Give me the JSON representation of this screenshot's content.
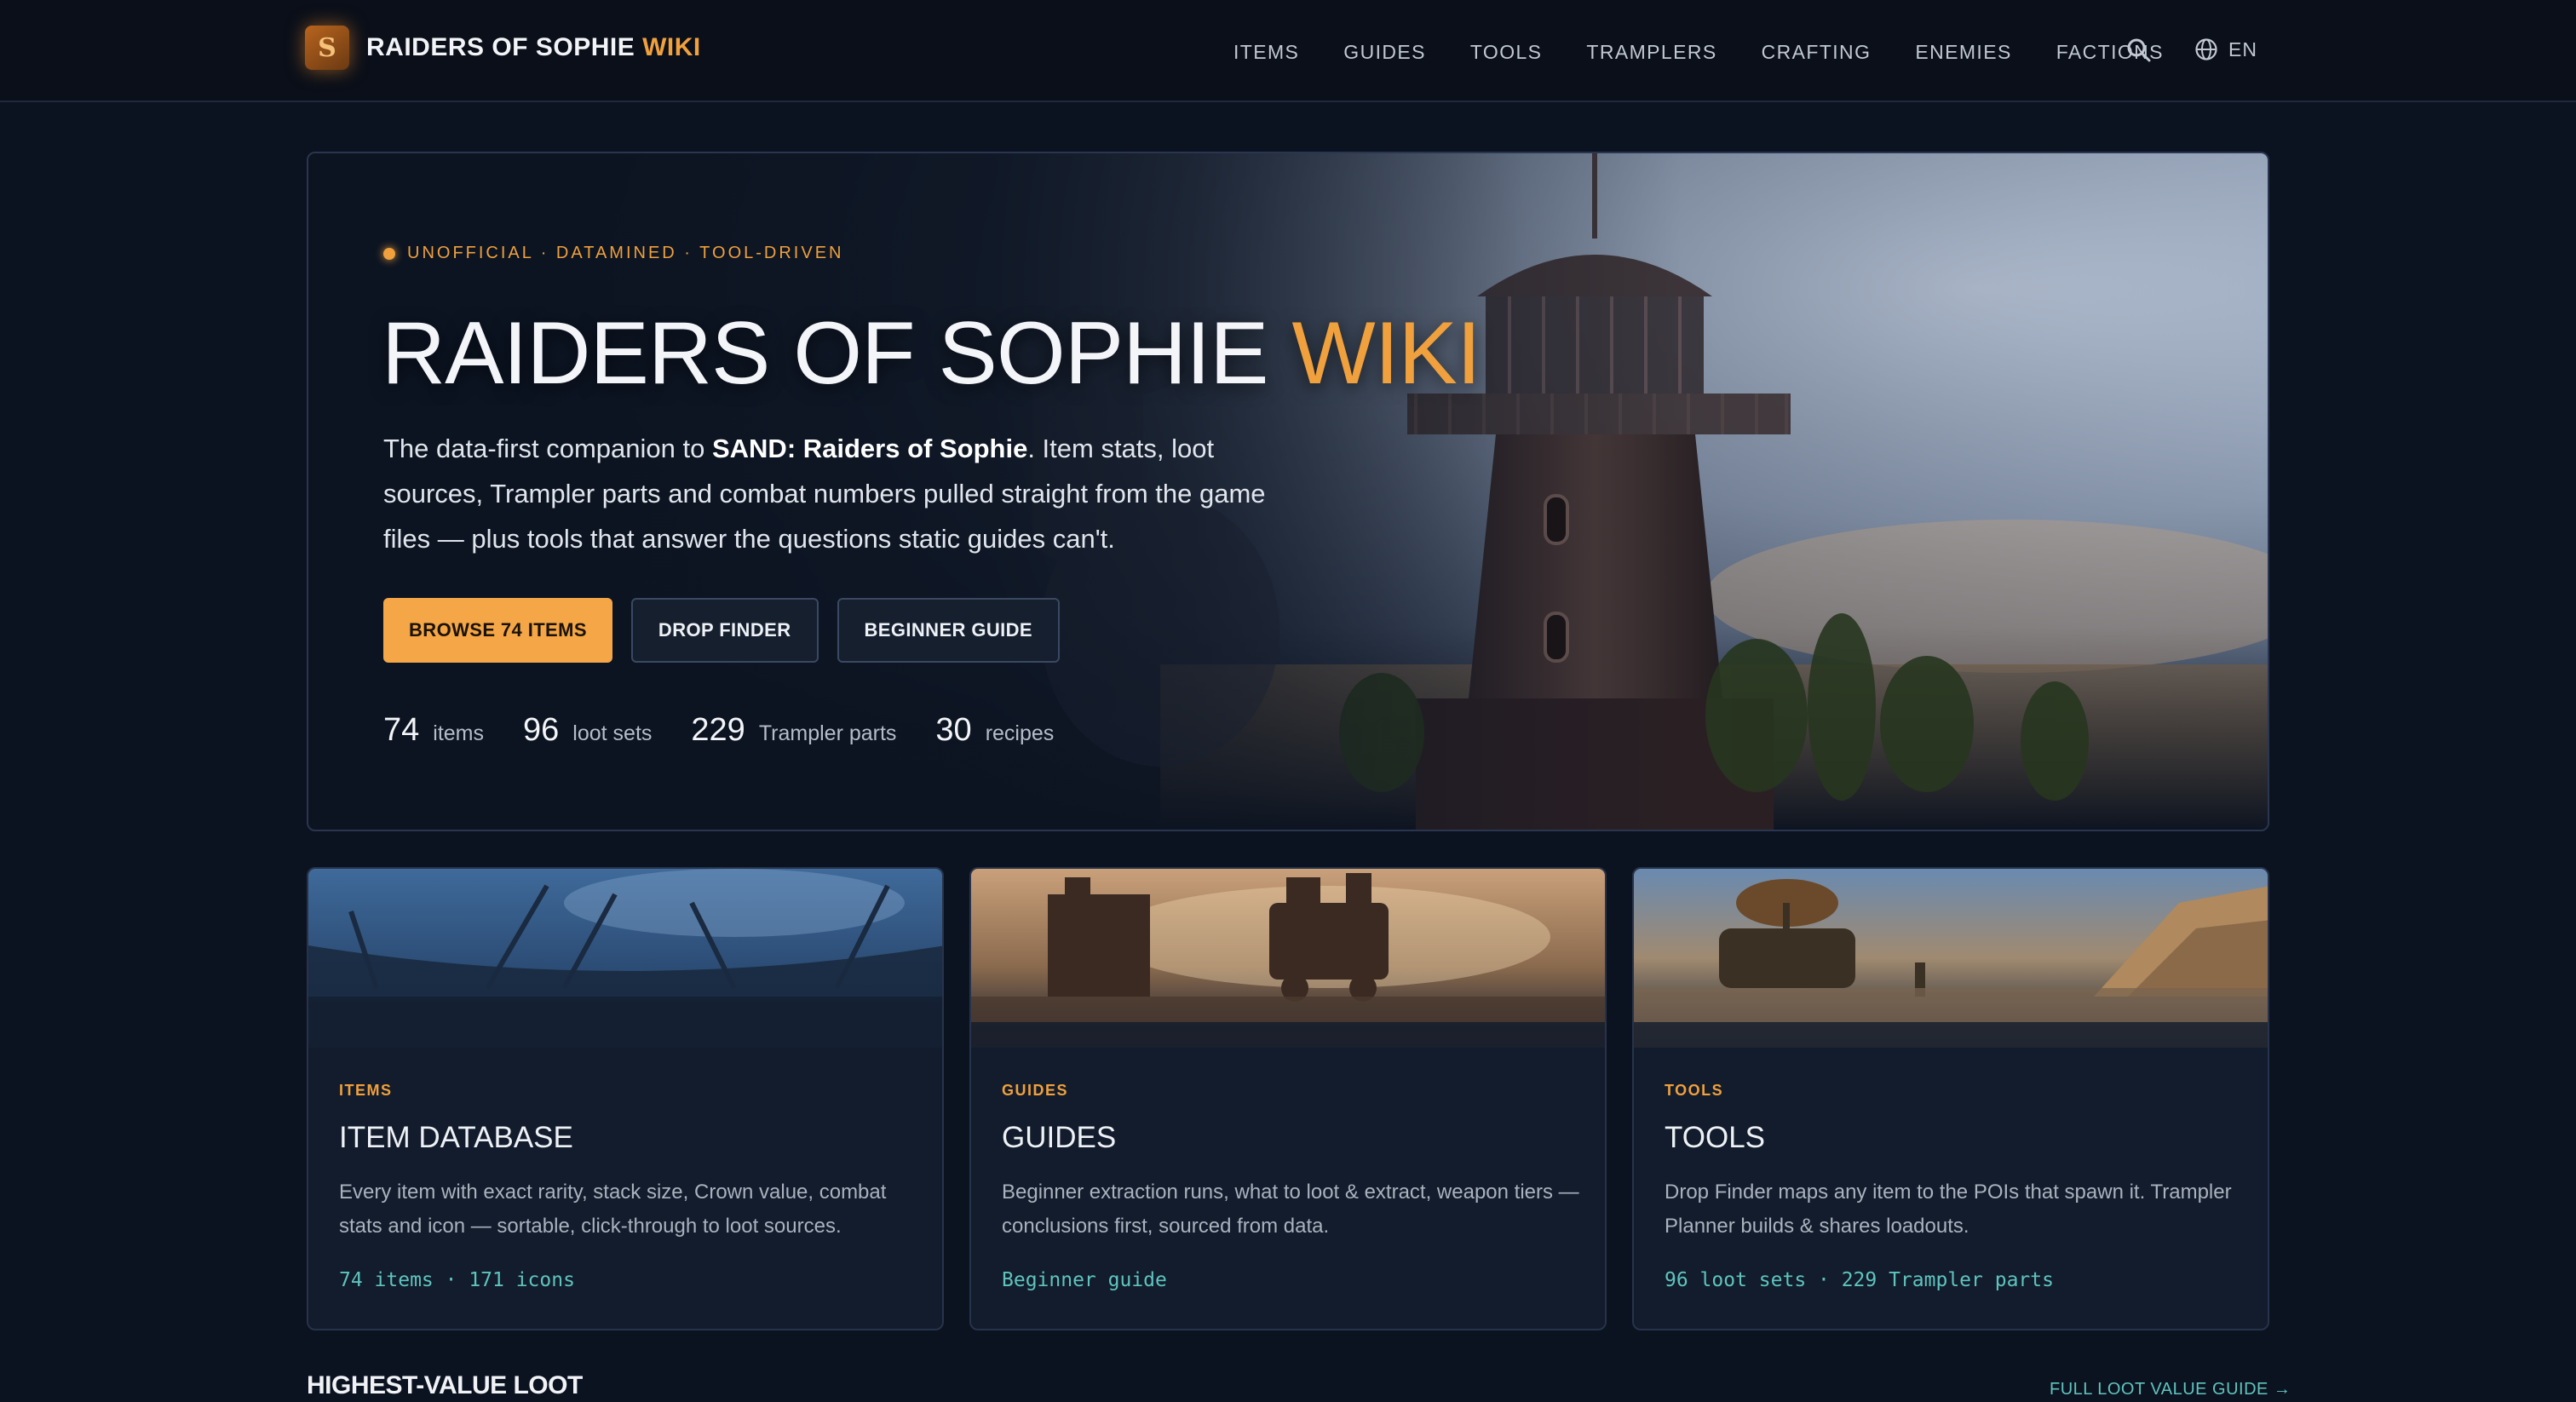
{
  "brand": {
    "title": "RAIDERS OF SOPHIE",
    "accent": "WIKI",
    "logo_letter": "S"
  },
  "nav": {
    "items": [
      "ITEMS",
      "GUIDES",
      "TOOLS",
      "TRAMPLERS",
      "CRAFTING",
      "ENEMIES",
      "FACTIONS"
    ],
    "search_icon": "search-icon",
    "language": "EN"
  },
  "hero": {
    "tagline": "UNOFFICIAL · DATAMINED · TOOL-DRIVEN",
    "title_main": "RAIDERS OF SOPHIE",
    "title_accent": "WIKI",
    "desc_prefix": "The data-first companion to",
    "desc_bold": "SAND: Raiders of Sophie",
    "desc_suffix": ". Item stats, loot sources, Trampler parts and combat numbers pulled straight from the game files — plus tools that answer the questions static guides can't.",
    "buttons": [
      "BROWSE 74 ITEMS",
      "DROP FINDER",
      "BEGINNER GUIDE"
    ],
    "stats": [
      {
        "value": "74",
        "label": "items"
      },
      {
        "value": "96",
        "label": "loot sets"
      },
      {
        "value": "229",
        "label": "Trampler parts"
      },
      {
        "value": "30",
        "label": "recipes"
      }
    ]
  },
  "cards": [
    {
      "category": "ITEMS",
      "title": "ITEM DATABASE",
      "desc": "Every item with exact rarity, stack size, Crown value, combat stats and icon — sortable, click-through to loot sources.",
      "meta": "74 items · 171 icons"
    },
    {
      "category": "GUIDES",
      "title": "GUIDES",
      "desc": "Beginner extraction runs, what to loot & extract, weapon tiers — conclusions first, sourced from data.",
      "meta": "Beginner guide"
    },
    {
      "category": "TOOLS",
      "title": "TOOLS",
      "desc": "Drop Finder maps any item to the POIs that spawn it. Trampler Planner builds & shares loadouts.",
      "meta": "96 loot sets · 229 Trampler parts"
    }
  ],
  "section": {
    "title": "HIGHEST-VALUE LOOT",
    "link": "FULL LOOT VALUE GUIDE →"
  },
  "colors": {
    "accent": "#f0a03c",
    "teal": "#5fc4be",
    "background": "#0c1320"
  }
}
